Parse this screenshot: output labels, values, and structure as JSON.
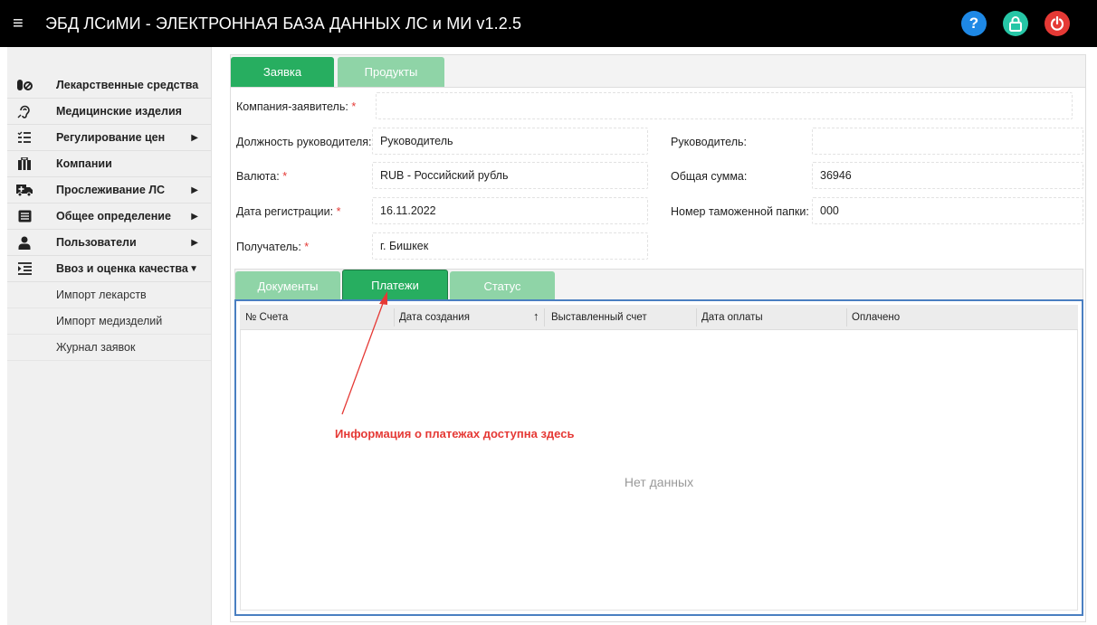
{
  "header": {
    "title": "ЭБД ЛСиМИ - ЭЛЕКТРОННАЯ БАЗА ДАННЫХ ЛС и МИ v1.2.5",
    "menu_icon": "≡",
    "help_icon": "?",
    "lock_icon": "🔒",
    "power_icon": "⏻"
  },
  "sidebar": {
    "items": [
      {
        "icon": "pills-icon",
        "label": "Лекарственные средства"
      },
      {
        "icon": "hearing-icon",
        "label": "Медицинские изделия"
      },
      {
        "icon": "list-check-icon",
        "label": "Регулирование цен"
      },
      {
        "icon": "building-icon",
        "label": "Компании"
      },
      {
        "icon": "ambulance-icon",
        "label": "Прослеживание ЛС"
      },
      {
        "icon": "list-icon",
        "label": "Общее определение"
      },
      {
        "icon": "user-icon",
        "label": "Пользователи"
      },
      {
        "icon": "indent-icon",
        "label": "Ввоз и оценка качества"
      }
    ],
    "subitems": [
      "Импорт лекарств",
      "Импорт медизделий",
      "Журнал заявок"
    ]
  },
  "tabs_top": [
    "Заявка",
    "Продукты"
  ],
  "form": {
    "applicant_label": "Компания-заявитель:",
    "applicant_value": "",
    "position_label": "Должность руководителя:",
    "position_value": "Руководитель",
    "head_label": "Руководитель:",
    "head_value": "",
    "currency_label": "Валюта:",
    "currency_value": "RUB - Российский рубль",
    "total_label": "Общая сумма:",
    "total_value": "36946",
    "regdate_label": "Дата регистрации:",
    "regdate_value": "16.11.2022",
    "customs_label": "Номер таможенной папки:",
    "customs_value": "000",
    "recipient_label": "Получатель:",
    "recipient_value": "г. Бишкек",
    "required_mark": "*"
  },
  "tabs_bottom": [
    "Документы",
    "Платежи",
    "Статус"
  ],
  "grid": {
    "columns": [
      "№ Счета",
      "Дата создания",
      "Выставленный счет",
      "Дата оплаты",
      "Оплачено"
    ],
    "sort_arrow": "↑",
    "empty_text": "Нет данных"
  },
  "annotation": "Информация о платежах доступна здесь",
  "colors": {
    "accent_green": "#27ae60",
    "inactive_green": "#8fd4a7",
    "annotation_red": "#e53935",
    "grid_border": "#4a7fc1"
  }
}
